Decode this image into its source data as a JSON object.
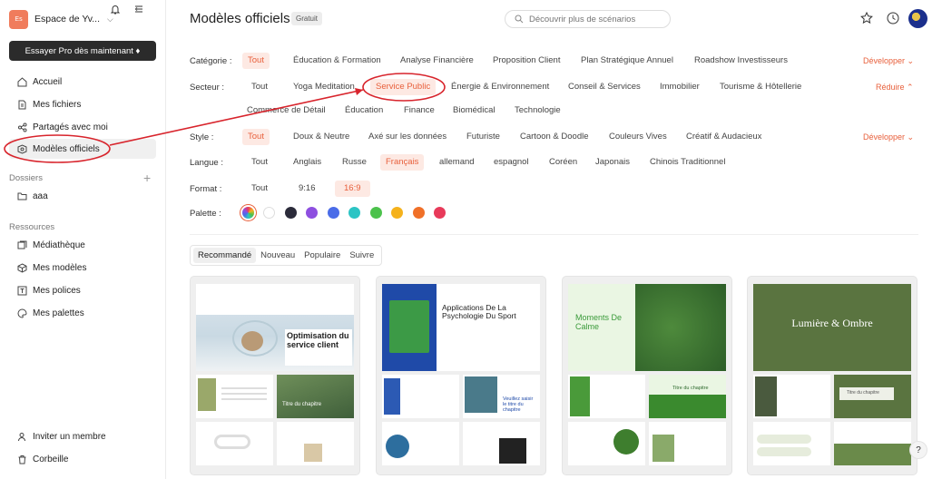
{
  "sidebar": {
    "workspace_initials": "Es",
    "workspace_name": "Espace de Yv...",
    "pro_button": "Essayer Pro dès maintenant ♦",
    "nav": [
      {
        "label": "Accueil",
        "icon": "home-icon"
      },
      {
        "label": "Mes fichiers",
        "icon": "file-icon"
      },
      {
        "label": "Partagés avec moi",
        "icon": "share-icon"
      },
      {
        "label": "Modèles officiels",
        "icon": "template-icon"
      }
    ],
    "folders_title": "Dossiers",
    "folders": [
      {
        "label": "aaa",
        "icon": "folder-icon"
      }
    ],
    "resources_title": "Ressources",
    "resources": [
      {
        "label": "Médiathèque",
        "icon": "media-icon"
      },
      {
        "label": "Mes modèles",
        "icon": "cube-icon"
      },
      {
        "label": "Mes polices",
        "icon": "font-icon"
      },
      {
        "label": "Mes palettes",
        "icon": "palette-icon"
      }
    ],
    "bottom": [
      {
        "label": "Inviter un membre",
        "icon": "user-add-icon"
      },
      {
        "label": "Corbeille",
        "icon": "trash-icon"
      }
    ]
  },
  "header": {
    "title": "Modèles officiels",
    "badge": "Gratuit",
    "search_placeholder": "Découvrir plus de scénarios"
  },
  "filters": {
    "category": {
      "label": "Catégorie :",
      "options": [
        "Tout",
        "Éducation & Formation",
        "Analyse Financière",
        "Proposition Client",
        "Plan Stratégique Annuel",
        "Roadshow Investisseurs"
      ],
      "selected": "Tout",
      "toggle": "Développer ⌄"
    },
    "sector": {
      "label": "Secteur :",
      "options_row1": [
        "Tout",
        "Yoga Meditation",
        "Service Public",
        "Énergie & Environnement",
        "Conseil & Services",
        "Immobilier",
        "Tourisme & Hôtellerie"
      ],
      "options_row2": [
        "Commerce de Détail",
        "Éducation",
        "Finance",
        "Biomédical",
        "Technologie"
      ],
      "selected": "Service Public",
      "toggle": "Réduire ⌃"
    },
    "style": {
      "label": "Style :",
      "options": [
        "Tout",
        "Doux & Neutre",
        "Axé sur les données",
        "Futuriste",
        "Cartoon & Doodle",
        "Couleurs Vives",
        "Créatif & Audacieux"
      ],
      "selected": "Tout",
      "toggle": "Développer ⌄"
    },
    "language": {
      "label": "Langue :",
      "options": [
        "Tout",
        "Anglais",
        "Russe",
        "Français",
        "allemand",
        "espagnol",
        "Coréen",
        "Japonais",
        "Chinois Traditionnel"
      ],
      "selected": "Français"
    },
    "format": {
      "label": "Format :",
      "options": [
        "Tout",
        "9:16",
        "16:9"
      ],
      "selected": "16:9"
    },
    "palette": {
      "label": "Palette :",
      "colors": [
        "#ffffff",
        "#2b2b3a",
        "#8e4fe0",
        "#4a6ce8",
        "#2cc4c4",
        "#4cc24c",
        "#f5b21c",
        "#f07028",
        "#e83a5a"
      ]
    }
  },
  "sort_tabs": [
    "Recommandé",
    "Nouveau",
    "Populaire",
    "Suivre"
  ],
  "active_sort": "Recommandé",
  "cards": [
    {
      "title": "Optimisation du service client",
      "small_title": "Titre du chapitre"
    },
    {
      "title": "Applications De La Psychologie Du Sport",
      "small_title": "Veuillez saisir le titre du chapitre"
    },
    {
      "title": "Moments De Calme",
      "small_title": "Titre du chapitre"
    },
    {
      "title": "Lumière & Ombre",
      "small_title": "Titre du chapitre"
    }
  ],
  "help": "?"
}
